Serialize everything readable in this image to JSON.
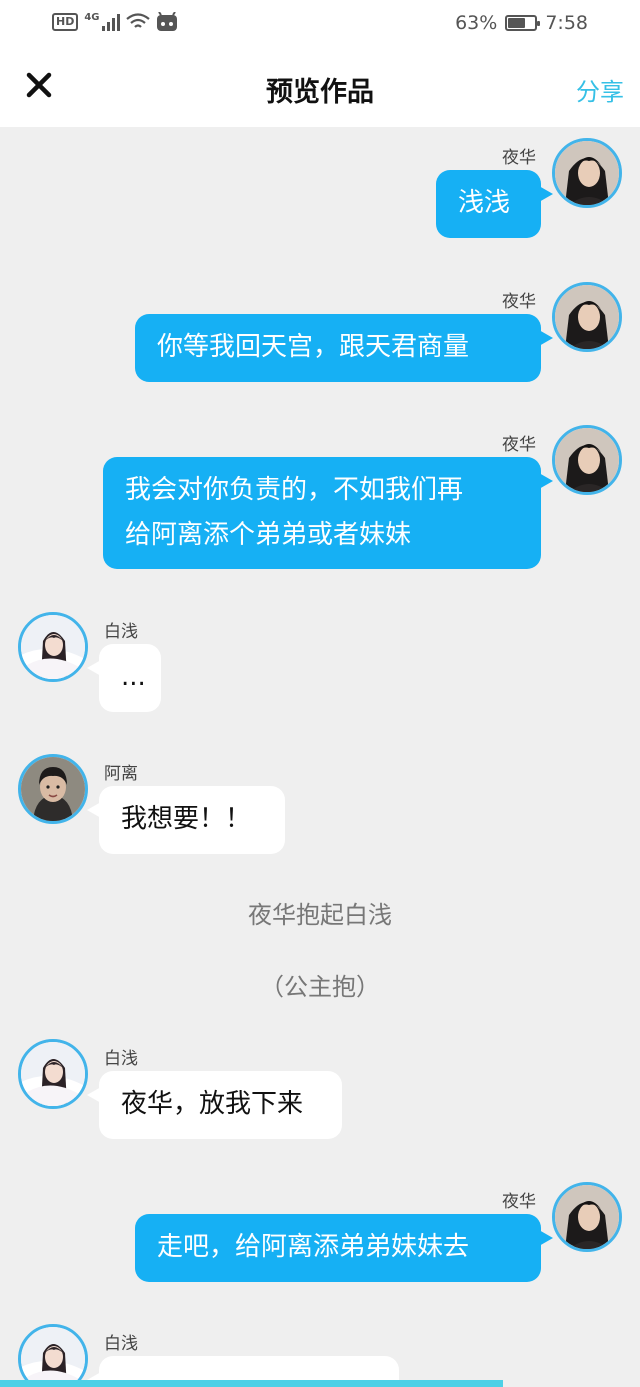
{
  "status_bar": {
    "left_icons": [
      "hd-icon",
      "4g-signal-icon",
      "wifi-icon",
      "notification-app-icon"
    ],
    "hd_label": "HD",
    "network_label": "4G",
    "battery_percent": "63%",
    "battery_level": 0.63,
    "time": "7:58"
  },
  "nav": {
    "close_icon": "close-icon",
    "title": "预览作品",
    "share_label": "分享"
  },
  "colors": {
    "accent": "#16b0f4",
    "share_text": "#36c0e6",
    "avatar_ring": "#42b4ea",
    "background": "#efefef"
  },
  "messages": [
    {
      "type": "message",
      "side": "right",
      "sender": "夜华",
      "avatar": "yehua-avatar",
      "lines": [
        "浅浅"
      ]
    },
    {
      "type": "message",
      "side": "right",
      "sender": "夜华",
      "avatar": "yehua-avatar",
      "lines": [
        "你等我回天宫，跟天君商量"
      ]
    },
    {
      "type": "message",
      "side": "right",
      "sender": "夜华",
      "avatar": "yehua-avatar",
      "lines": [
        "我会对你负责的，不如我们再",
        "给阿离添个弟弟或者妹妹"
      ]
    },
    {
      "type": "message",
      "side": "left",
      "sender": "白浅",
      "avatar": "baiqian-avatar",
      "lines": [
        "..."
      ]
    },
    {
      "type": "message",
      "side": "left",
      "sender": "阿离",
      "avatar": "ali-avatar",
      "lines": [
        "我想要！！"
      ]
    },
    {
      "type": "narration",
      "text": "夜华抱起白浅"
    },
    {
      "type": "narration",
      "text": "（公主抱）"
    },
    {
      "type": "message",
      "side": "left",
      "sender": "白浅",
      "avatar": "baiqian-avatar",
      "lines": [
        "夜华，放我下来"
      ]
    },
    {
      "type": "message",
      "side": "right",
      "sender": "夜华",
      "avatar": "yehua-avatar",
      "lines": [
        "走吧，给阿离添弟弟妹妹去"
      ]
    },
    {
      "type": "message",
      "side": "left",
      "sender": "白浅",
      "avatar": "baiqian-avatar",
      "lines": [
        ""
      ]
    }
  ]
}
